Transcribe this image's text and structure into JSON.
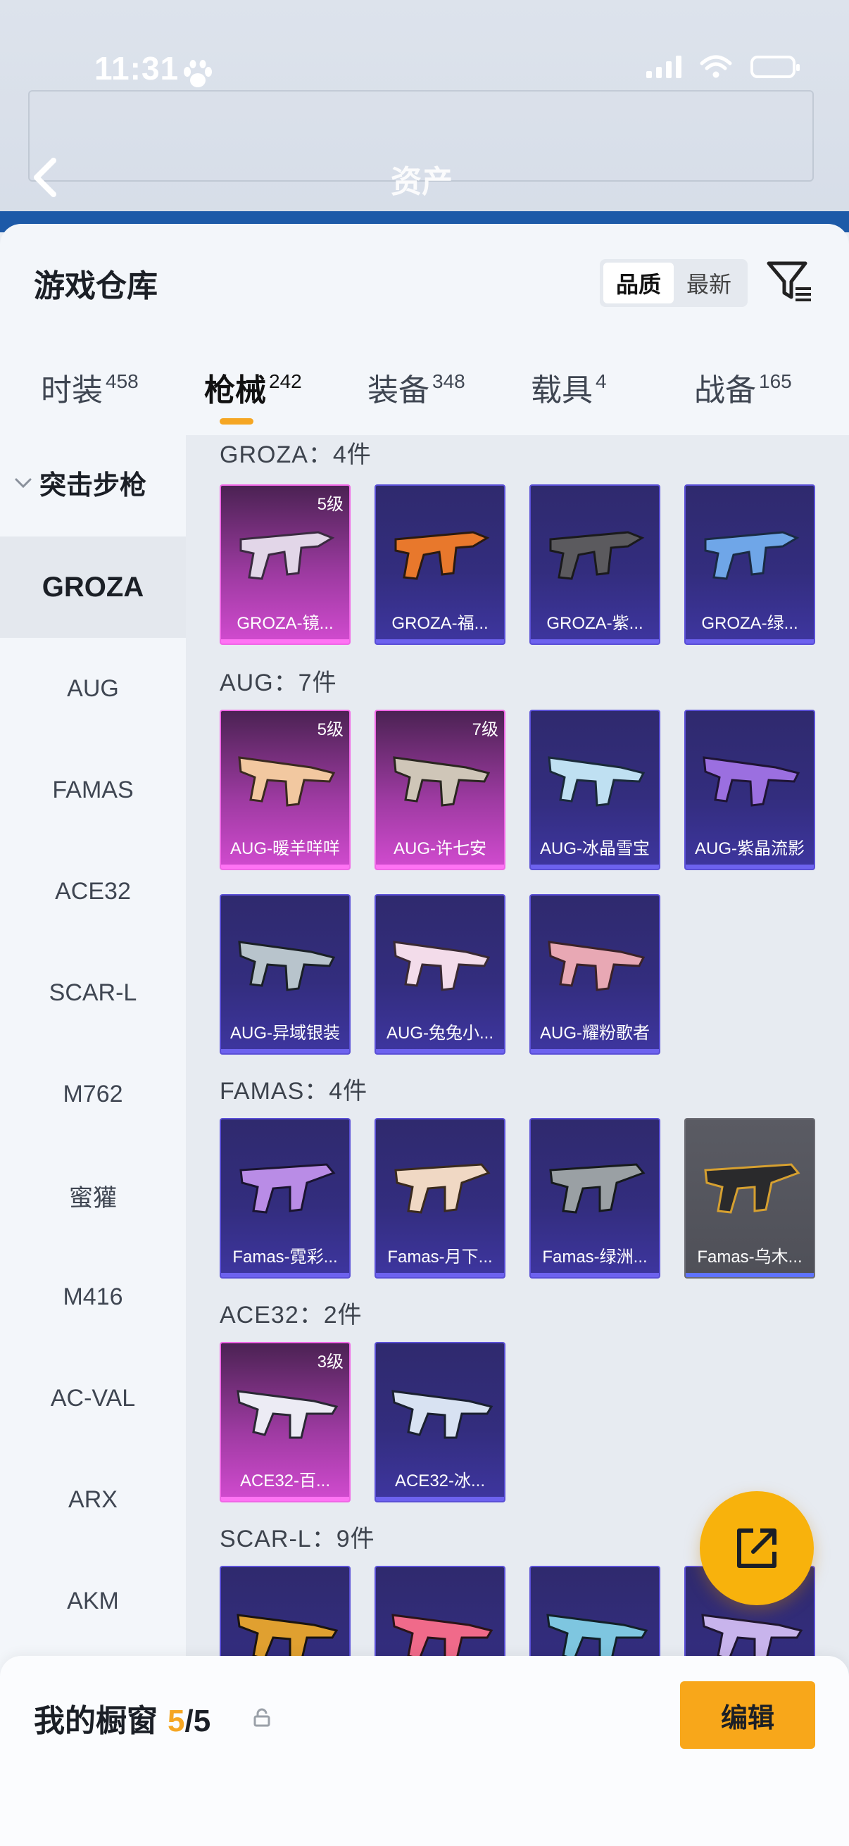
{
  "status_bar": {
    "time": "11:31"
  },
  "backdrop": {
    "asset_title": "资产"
  },
  "header": {
    "title": "游戏仓库",
    "sort_options": [
      "品质",
      "最新"
    ],
    "sort_selected": "品质"
  },
  "tabs": [
    {
      "label": "时装",
      "count": "458"
    },
    {
      "label": "枪械",
      "count": "242",
      "active": true
    },
    {
      "label": "装备",
      "count": "348"
    },
    {
      "label": "载具",
      "count": "4"
    },
    {
      "label": "战备",
      "count": "165"
    }
  ],
  "sidebar": {
    "category": "突击步枪",
    "items": [
      "GROZA",
      "AUG",
      "FAMAS",
      "ACE32",
      "SCAR-L",
      "M762",
      "蜜獾",
      "M416",
      "AC-VAL",
      "ARX",
      "AKM"
    ],
    "selected": "GROZA"
  },
  "groups": [
    {
      "title": "GROZA：4件",
      "items": [
        {
          "name": "GROZA-镜...",
          "tier": "pink",
          "level": "5级"
        },
        {
          "name": "GROZA-福...",
          "tier": "purple",
          "level": ""
        },
        {
          "name": "GROZA-紫...",
          "tier": "purple",
          "level": ""
        },
        {
          "name": "GROZA-绿...",
          "tier": "purple",
          "level": ""
        }
      ]
    },
    {
      "title": "AUG：7件",
      "items": [
        {
          "name": "AUG-暖羊咩咩",
          "tier": "pink",
          "level": "5级"
        },
        {
          "name": "AUG-许七安",
          "tier": "pink",
          "level": "7级"
        },
        {
          "name": "AUG-冰晶雪宝",
          "tier": "purple",
          "level": ""
        },
        {
          "name": "AUG-紫晶流影",
          "tier": "purple",
          "level": ""
        },
        {
          "name": "AUG-异域银装",
          "tier": "purple",
          "level": ""
        },
        {
          "name": "AUG-兔兔小...",
          "tier": "purple",
          "level": ""
        },
        {
          "name": "AUG-耀粉歌者",
          "tier": "purple",
          "level": ""
        }
      ]
    },
    {
      "title": "FAMAS：4件",
      "items": [
        {
          "name": "Famas-霓彩...",
          "tier": "purple",
          "level": ""
        },
        {
          "name": "Famas-月下...",
          "tier": "purple",
          "level": ""
        },
        {
          "name": "Famas-绿洲...",
          "tier": "purple",
          "level": ""
        },
        {
          "name": "Famas-乌木...",
          "tier": "gray",
          "level": ""
        }
      ]
    },
    {
      "title": "ACE32：2件",
      "items": [
        {
          "name": "ACE32-百...",
          "tier": "pink",
          "level": "3级"
        },
        {
          "name": "ACE32-冰...",
          "tier": "purple",
          "level": ""
        }
      ]
    },
    {
      "title": "SCAR-L：9件",
      "items": [
        {
          "name": "",
          "tier": "purple",
          "level": ""
        },
        {
          "name": "",
          "tier": "purple",
          "level": ""
        },
        {
          "name": "",
          "tier": "purple",
          "level": ""
        },
        {
          "name": "",
          "tier": "purple",
          "level": ""
        }
      ]
    }
  ],
  "bottom_bar": {
    "showcase_label": "我的橱窗",
    "showcase_used": "5",
    "showcase_total": "/5",
    "edit_label": "编辑"
  },
  "colors": {
    "accent": "#f5a623",
    "tier_pink": "#f067e6",
    "tier_purple": "#5a4fd6",
    "tier_gray": "#6c6c74"
  },
  "icons": [
    "back-arrow-icon",
    "filter-icon",
    "chevron-down-icon",
    "share-icon",
    "lock-icon",
    "paw-icon",
    "signal-icon",
    "wifi-icon",
    "battery-icon"
  ]
}
